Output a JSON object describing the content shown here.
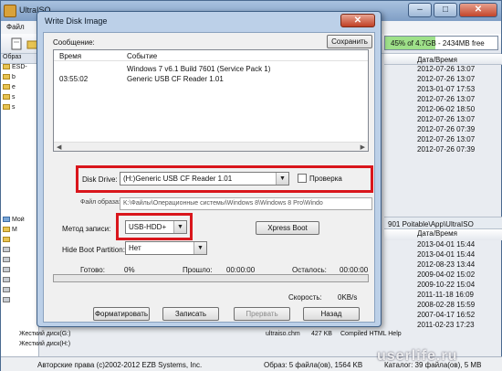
{
  "main": {
    "title": "UltraISO",
    "menu_first": "Файл",
    "free_space": "45% of 4.7GB - 2434MB free",
    "free_fraction": 0.45,
    "left_pane_header": "Образ",
    "left_items": [
      "ESD-",
      "b",
      "e",
      "s",
      "s"
    ],
    "left_items2": [
      "Мой",
      "M",
      "",
      "",
      "",
      "",
      "",
      "",
      "",
      ""
    ],
    "right_header": "Дата/Время",
    "dates_top": [
      "2012-07-26 13:07",
      "2012-07-26 13:07",
      "2013-01-07 17:53",
      "2012-07-26 13:07",
      "2012-06-02 18:50",
      "2012-07-26 13:07",
      "2012-07-26 07:39",
      "2012-07-26 13:07",
      "2012-07-26 07:39"
    ],
    "path_bar": "901 Poitable\\App\\UltraISO",
    "dates_bottom": [
      "2013-04-01 15:44",
      "2013-04-01 15:44",
      "2012-08-23 13:44",
      "2009-04-02 15:02",
      "2009-10-22 15:04",
      "2011-11-18 16:09",
      "2008-02-28 15:59",
      "2007-04-17 16:52",
      "2011-02-23 17:23"
    ],
    "bottom_rows": [
      {
        "label": "Жесткий диск(G:)",
        "file": "ultraiso.chm",
        "size": "427 KB",
        "type": "Compiled HTML Help"
      },
      {
        "label": "Жесткий диск(H:)",
        "file": "",
        "size": "",
        "type": ""
      }
    ],
    "status": {
      "copyright": "Авторские права (c)2002-2012 EZB Systems, Inc.",
      "image_info": "Образ: 5 файла(ов), 1564 KB",
      "local_info": "Каталог: 39 файла(ов), 5 MB"
    },
    "watermark": "userlife.ru"
  },
  "dialog": {
    "title": "Write Disk Image",
    "close_glyph": "✕",
    "message_label": "Сообщение:",
    "save_button": "Сохранить",
    "log_headers": {
      "time": "Время",
      "event": "Событие"
    },
    "log_lines": [
      {
        "time": "",
        "event": "Windows 7 v6.1 Build 7601 (Service Pack 1)"
      },
      {
        "time": "03:55:02",
        "event": "Generic USB CF Reader   1.01"
      }
    ],
    "disk_drive_label": "Disk Drive:",
    "disk_drive_value": "(H:)Generic USB CF Reader   1.01",
    "verify_label": "Проверка",
    "image_file_label": "Файл образа:",
    "image_file_value": "K:\\Файлы\\Операционные системы\\Windows 8\\Windows 8 Pro\\Windo",
    "write_method_label": "Метод записи:",
    "write_method_value": "USB-HDD+",
    "xpress_boot_button": "Xpress Boot",
    "hide_boot_label": "Hide Boot Partition:",
    "hide_boot_value": "Нет",
    "done_label": "Готово:",
    "done_value": "0%",
    "elapsed_label": "Прошло:",
    "elapsed_value": "00:00:00",
    "remaining_label": "Осталось:",
    "remaining_value": "00:00:00",
    "speed_label": "Скорость:",
    "speed_value": "0KB/s",
    "progress_fraction": 0,
    "buttons": {
      "format": "Форматировать",
      "write": "Записать",
      "abort": "Прервать",
      "back": "Назад"
    }
  },
  "colors": {
    "highlight": "#d9161c",
    "progress": "#4fbf4a"
  }
}
